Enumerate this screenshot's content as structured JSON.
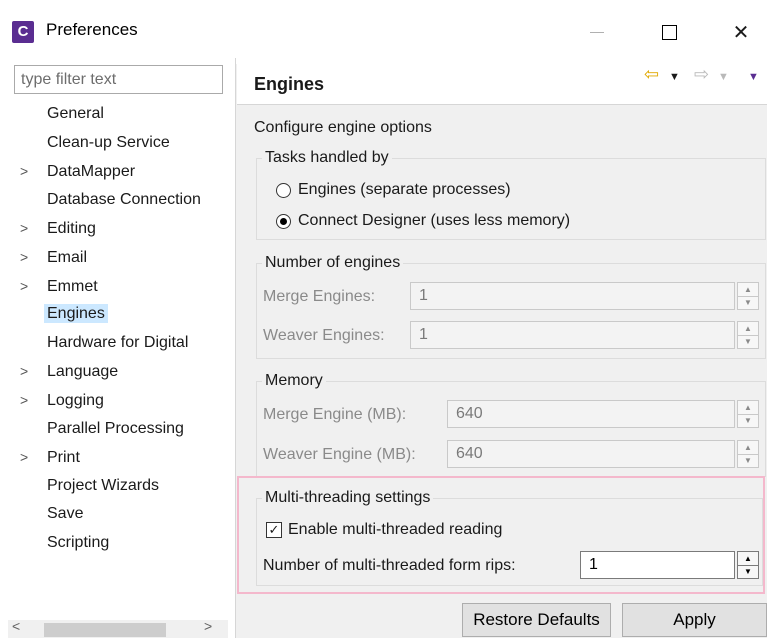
{
  "window": {
    "title": "Preferences",
    "app_icon_letter": "C",
    "minimize_glyph": "—",
    "maximize_glyph": "□",
    "close_glyph": "✕"
  },
  "filter": {
    "placeholder": "type filter text"
  },
  "tree": {
    "items": [
      {
        "label": "General",
        "expandable": false
      },
      {
        "label": "Clean-up Service",
        "expandable": false
      },
      {
        "label": "DataMapper",
        "expandable": true
      },
      {
        "label": "Database Connection",
        "expandable": false
      },
      {
        "label": "Editing",
        "expandable": true
      },
      {
        "label": "Email",
        "expandable": true
      },
      {
        "label": "Emmet",
        "expandable": true
      },
      {
        "label": "Engines",
        "expandable": false,
        "selected": true
      },
      {
        "label": "Hardware for Digital",
        "expandable": false
      },
      {
        "label": "Language",
        "expandable": true
      },
      {
        "label": "Logging",
        "expandable": true
      },
      {
        "label": "Parallel Processing",
        "expandable": false
      },
      {
        "label": "Print",
        "expandable": true
      },
      {
        "label": "Project Wizards",
        "expandable": false
      },
      {
        "label": "Save",
        "expandable": false
      },
      {
        "label": "Scripting",
        "expandable": false
      }
    ],
    "chevron_glyph": ">",
    "scroll_left": "<",
    "scroll_right": ">"
  },
  "page": {
    "title": "Engines",
    "description": "Configure engine options",
    "nav": {
      "back": "⇦",
      "dropdown": "▼",
      "forward": "⇨",
      "menu": "▼"
    }
  },
  "tasks": {
    "legend": "Tasks handled by",
    "option_engines": "Engines (separate processes)",
    "option_designer": "Connect Designer (uses less memory)",
    "selected": "designer"
  },
  "engines_count": {
    "legend": "Number of engines",
    "merge_label": "Merge Engines:",
    "merge_value": "1",
    "weaver_label": "Weaver Engines:",
    "weaver_value": "1"
  },
  "memory": {
    "legend": "Memory",
    "merge_label": "Merge Engine (MB):",
    "merge_value": "640",
    "weaver_label": "Weaver Engine (MB):",
    "weaver_value": "640"
  },
  "multithread": {
    "legend": "Multi-threading settings",
    "enable_label": "Enable multi-threaded reading",
    "enable_checked": true,
    "check_glyph": "✓",
    "rips_label": "Number of multi-threaded form rips:",
    "rips_value": "1"
  },
  "spin_glyphs": {
    "up": "▲",
    "down": "▼"
  },
  "buttons": {
    "restore": "Restore Defaults",
    "apply": "Apply"
  },
  "colors": {
    "selection": "#cce8ff",
    "highlight_border": "#f4b8cc",
    "app_icon": "#5a2d91",
    "nav_back": "#e0a800"
  }
}
